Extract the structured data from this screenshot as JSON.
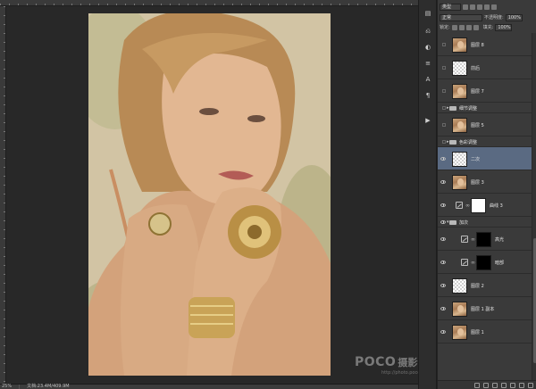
{
  "status": {
    "zoom": "25%",
    "doc_info": "文档:23.4M/409.9M"
  },
  "watermark": {
    "logo": "POCO",
    "cn": "摄影专题",
    "url": "http://photo.poco.cn/"
  },
  "layers_panel": {
    "filter_kind": "类型",
    "blend_mode": "正常",
    "opacity_label": "不透明度:",
    "opacity_value": "100%",
    "lock_label": "锁定:",
    "fill_label": "填充:",
    "fill_value": "100%",
    "layers": [
      {
        "name": "图层 8",
        "visible": false,
        "kind": "pixel",
        "thumb": "face"
      },
      {
        "name": "前后",
        "visible": false,
        "kind": "pixel",
        "thumb": "trans"
      },
      {
        "name": "图层 7",
        "visible": false,
        "kind": "pixel",
        "thumb": "face"
      },
      {
        "name": "细节调整",
        "visible": false,
        "kind": "group"
      },
      {
        "name": "图层 5",
        "visible": false,
        "kind": "pixel",
        "thumb": "face"
      },
      {
        "name": "色彩调整",
        "visible": false,
        "kind": "group"
      },
      {
        "name": "二次",
        "visible": true,
        "kind": "pixel",
        "thumb": "trans",
        "selected": true
      },
      {
        "name": "图层 3",
        "visible": true,
        "kind": "pixel",
        "thumb": "face"
      },
      {
        "name": "曲线 3",
        "visible": true,
        "kind": "adjust",
        "mask": "white"
      },
      {
        "name": "加次",
        "visible": true,
        "kind": "group-open"
      },
      {
        "name": "高光",
        "visible": true,
        "kind": "adjust",
        "mask": "black",
        "indent": true
      },
      {
        "name": "暗部",
        "visible": true,
        "kind": "adjust",
        "mask": "black",
        "indent": true
      },
      {
        "name": "图层 2",
        "visible": true,
        "kind": "pixel",
        "thumb": "trans"
      },
      {
        "name": "图层 1 副本",
        "visible": true,
        "kind": "pixel",
        "thumb": "face"
      },
      {
        "name": "图层 1",
        "visible": true,
        "kind": "pixel",
        "thumb": "face"
      }
    ]
  },
  "tool_icons": [
    "layers-icon",
    "history-icon",
    "adjustments-icon",
    "channels-icon",
    "character-icon",
    "paragraph-icon",
    "play-icon"
  ]
}
